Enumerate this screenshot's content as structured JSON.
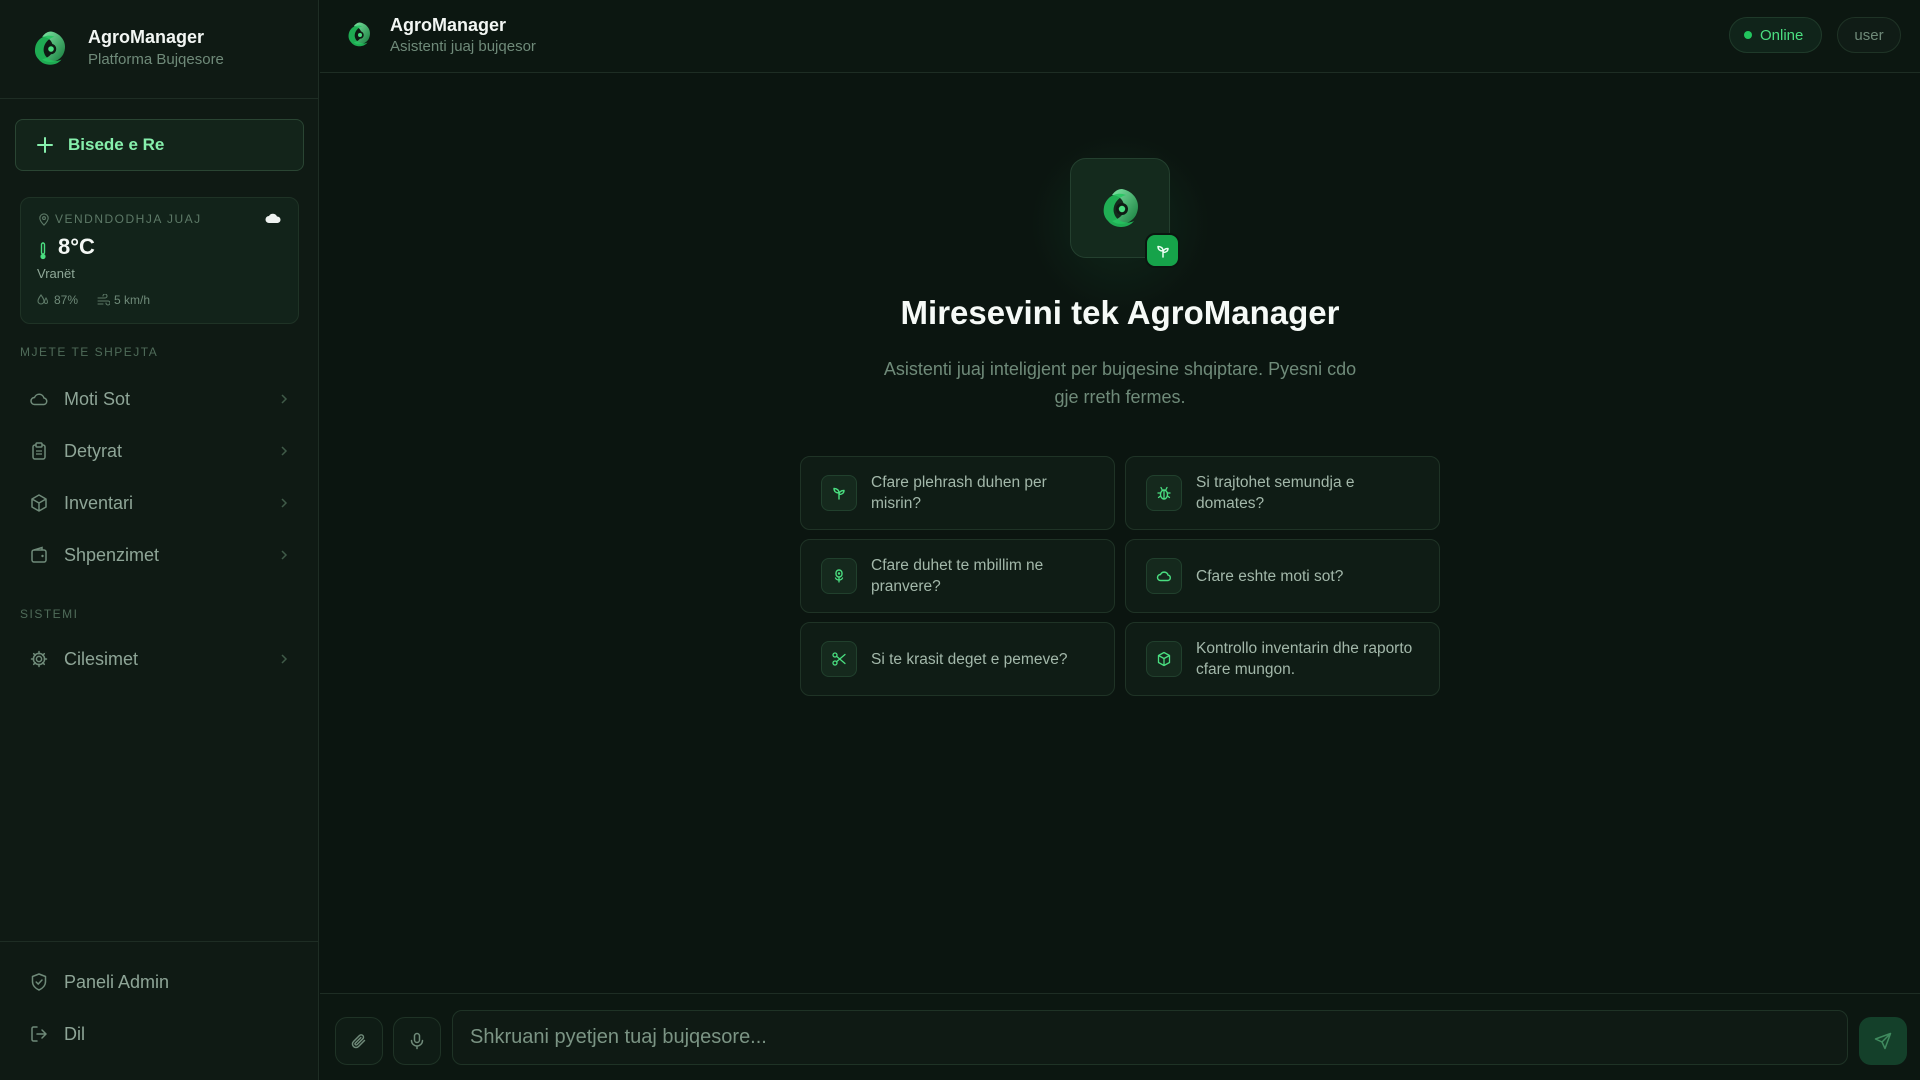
{
  "app": {
    "name": "AgroManager",
    "tagline": "Platforma Bujqesore",
    "logo_icon": "agro-logo-icon",
    "accent_color": "#4ade80",
    "background_color": "#0b1510"
  },
  "sidebar": {
    "new_chat_label": "Bisede e Re",
    "weather": {
      "location_label": "VENDNDODHJA JUAJ",
      "temperature": "8°C",
      "condition": "Vranët",
      "humidity": "87%",
      "wind": "5 km/h",
      "condition_icon": "cloud-icon"
    },
    "quick_tools_title": "MJETE TE SHPEJTA",
    "quick_tools": [
      {
        "label": "Moti Sot",
        "icon": "cloud-icon"
      },
      {
        "label": "Detyrat",
        "icon": "clipboard-icon"
      },
      {
        "label": "Inventari",
        "icon": "package-icon"
      },
      {
        "label": "Shpenzimet",
        "icon": "wallet-icon"
      }
    ],
    "system_title": "SISTEMI",
    "system_items": [
      {
        "label": "Cilesimet",
        "icon": "gear-icon"
      }
    ],
    "bottom_items": [
      {
        "label": "Paneli Admin",
        "icon": "shield-check-icon"
      },
      {
        "label": "Dil",
        "icon": "logout-icon"
      }
    ]
  },
  "header": {
    "title": "AgroManager",
    "subtitle": "Asistenti juaj bujqesor",
    "status": "Online",
    "status_color": "#22c55e",
    "user": "user"
  },
  "main": {
    "welcome_title": "Miresevini tek AgroManager",
    "welcome_subtitle": "Asistenti juaj inteligjent per bujqesine shqiptare. Pyesni cdo gje rreth fermes.",
    "suggestions": [
      {
        "text": "Cfare plehrash duhen per misrin?",
        "icon": "sprout-icon"
      },
      {
        "text": "Si trajtohet semundja e domates?",
        "icon": "bug-icon"
      },
      {
        "text": "Cfare duhet te mbillim ne pranvere?",
        "icon": "flower-icon"
      },
      {
        "text": "Cfare eshte moti sot?",
        "icon": "cloud-icon"
      },
      {
        "text": "Si te krasit deget e pemeve?",
        "icon": "scissors-icon"
      },
      {
        "text": "Kontrollo inventarin dhe raporto cfare mungon.",
        "icon": "package-icon"
      }
    ]
  },
  "composer": {
    "placeholder": "Shkruani pyetjen tuaj bujqesore...",
    "value": "",
    "attach_icon": "paperclip-icon",
    "mic_icon": "microphone-icon",
    "send_icon": "send-icon"
  }
}
